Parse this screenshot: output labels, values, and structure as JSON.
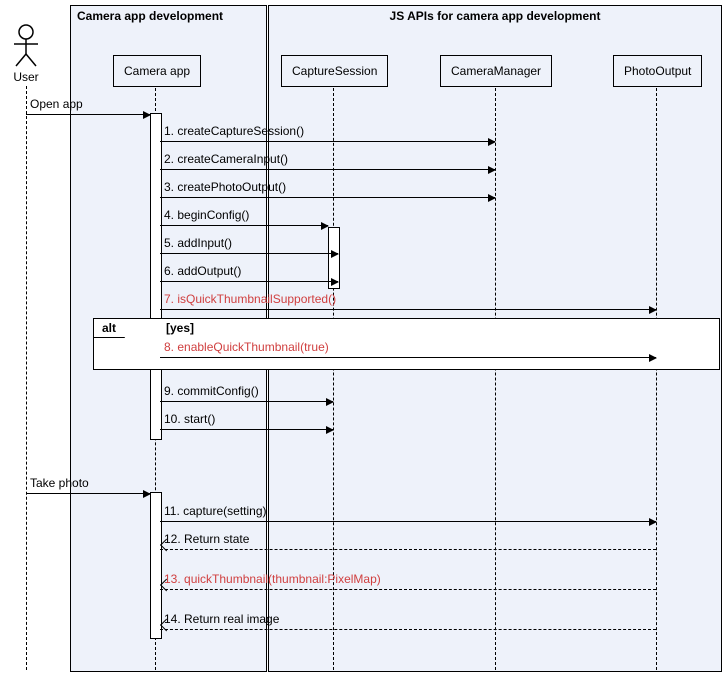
{
  "actor": {
    "label": "User"
  },
  "boxes": {
    "dev": {
      "title": "Camera app development"
    },
    "jsapi": {
      "title": "JS APIs for camera app development"
    }
  },
  "participants": {
    "app": {
      "label": "Camera app"
    },
    "sess": {
      "label": "CaptureSession"
    },
    "mgr": {
      "label": "CameraManager"
    },
    "photo": {
      "label": "PhotoOutput"
    }
  },
  "messages": {
    "open": {
      "label": "Open app"
    },
    "m1": {
      "label": "1. createCaptureSession()"
    },
    "m2": {
      "label": "2. createCameraInput()"
    },
    "m3": {
      "label": "3. createPhotoOutput()"
    },
    "m4": {
      "label": "4. beginConfig()"
    },
    "m5": {
      "label": "5. addInput()"
    },
    "m6": {
      "label": "6. addOutput()"
    },
    "m7": {
      "label": "7. isQuickThumbnailSupported()"
    },
    "m8": {
      "label": "8. enableQuickThumbnail(true)"
    },
    "m9": {
      "label": "9. commitConfig()"
    },
    "m10": {
      "label": "10. start()"
    },
    "take": {
      "label": "Take photo"
    },
    "m11": {
      "label": "11. capture(setting)"
    },
    "m12": {
      "label": "12. Return state"
    },
    "m13": {
      "label": "13. quickThumbnail(thumbnail:PixelMap)"
    },
    "m14": {
      "label": "14. Return real image"
    }
  },
  "alt": {
    "label": "alt",
    "condition": "[yes]"
  },
  "chart_data": {
    "type": "table",
    "title": "UML sequence diagram: quick-thumbnail photo capture flow",
    "actors": [
      "User"
    ],
    "boxes": [
      {
        "name": "Camera app development",
        "participants": [
          "Camera app"
        ]
      },
      {
        "name": "JS APIs for camera app development",
        "participants": [
          "CaptureSession",
          "CameraManager",
          "PhotoOutput"
        ]
      }
    ],
    "sequence": [
      {
        "n": null,
        "from": "User",
        "to": "Camera app",
        "msg": "Open app",
        "style": "sync"
      },
      {
        "n": 1,
        "from": "Camera app",
        "to": "CameraManager",
        "msg": "createCaptureSession()",
        "style": "sync"
      },
      {
        "n": 2,
        "from": "Camera app",
        "to": "CameraManager",
        "msg": "createCameraInput()",
        "style": "sync"
      },
      {
        "n": 3,
        "from": "Camera app",
        "to": "CameraManager",
        "msg": "createPhotoOutput()",
        "style": "sync"
      },
      {
        "n": 4,
        "from": "Camera app",
        "to": "CaptureSession",
        "msg": "beginConfig()",
        "style": "sync"
      },
      {
        "n": 5,
        "from": "Camera app",
        "to": "CaptureSession",
        "msg": "addInput()",
        "style": "sync"
      },
      {
        "n": 6,
        "from": "Camera app",
        "to": "CaptureSession",
        "msg": "addOutput()",
        "style": "sync"
      },
      {
        "n": 7,
        "from": "Camera app",
        "to": "PhotoOutput",
        "msg": "isQuickThumbnailSupported()",
        "style": "sync",
        "highlight": true
      },
      {
        "alt": "yes",
        "steps": [
          {
            "n": 8,
            "from": "Camera app",
            "to": "PhotoOutput",
            "msg": "enableQuickThumbnail(true)",
            "style": "sync",
            "highlight": true
          }
        ]
      },
      {
        "n": 9,
        "from": "Camera app",
        "to": "CaptureSession",
        "msg": "commitConfig()",
        "style": "sync"
      },
      {
        "n": 10,
        "from": "Camera app",
        "to": "CaptureSession",
        "msg": "start()",
        "style": "sync"
      },
      {
        "n": null,
        "from": "User",
        "to": "Camera app",
        "msg": "Take photo",
        "style": "sync"
      },
      {
        "n": 11,
        "from": "Camera app",
        "to": "PhotoOutput",
        "msg": "capture(setting)",
        "style": "sync"
      },
      {
        "n": 12,
        "from": "PhotoOutput",
        "to": "Camera app",
        "msg": "Return state",
        "style": "return"
      },
      {
        "n": 13,
        "from": "PhotoOutput",
        "to": "Camera app",
        "msg": "quickThumbnail(thumbnail:PixelMap)",
        "style": "return",
        "highlight": true
      },
      {
        "n": 14,
        "from": "PhotoOutput",
        "to": "Camera app",
        "msg": "Return real image",
        "style": "return"
      }
    ]
  }
}
